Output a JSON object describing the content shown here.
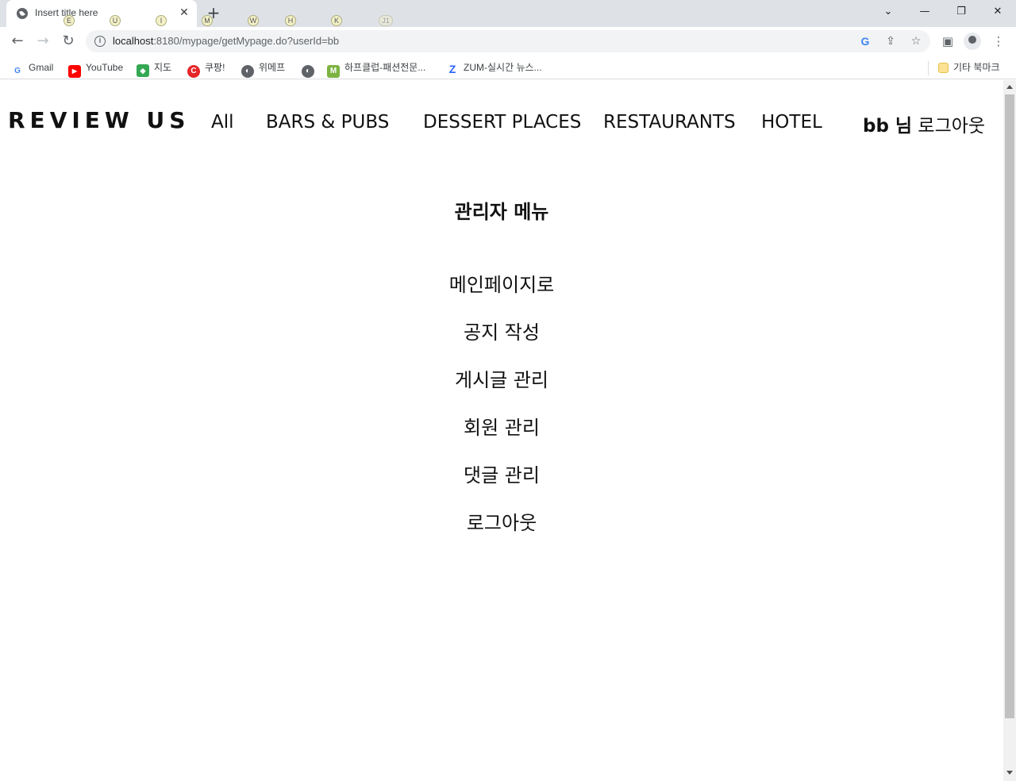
{
  "browser": {
    "tab_title": "Insert title here",
    "hints": [
      "E",
      "U",
      "I",
      "M",
      "W",
      "H",
      "K",
      "J1"
    ],
    "url_host": "localhost",
    "url_rest": ":8180/mypage/getMypage.do?userId=bb",
    "bookmarks": [
      {
        "label": "Gmail",
        "icon": "google-icon",
        "color": "#4285f4"
      },
      {
        "label": "YouTube",
        "icon": "youtube-icon",
        "color": "#ff0000"
      },
      {
        "label": "지도",
        "icon": "maps-icon",
        "color": "#34a853"
      },
      {
        "label": "쿠팡!",
        "icon": "coupang-icon",
        "color": "#e52528"
      },
      {
        "label": "위메프",
        "icon": "globe-icon",
        "color": "#5f6368"
      },
      {
        "label": "",
        "icon": "globe-icon",
        "color": "#5f6368"
      },
      {
        "label": "하프클럽-패션전문...",
        "icon": "halfclub-icon",
        "color": "#7cb342"
      },
      {
        "label": "ZUM-실시간 뉴스...",
        "icon": "zum-icon",
        "color": "#2962ff"
      }
    ],
    "other_bookmarks": "기타 북마크"
  },
  "site": {
    "logo": "REVIEW US",
    "nav": [
      "All",
      "BARS & PUBS",
      "DESSERT PLACES",
      "RESTAURANTS",
      "HOTEL"
    ],
    "user_name": "bb 님",
    "logout": "로그아웃"
  },
  "admin": {
    "title": "관리자 메뉴",
    "menu": [
      "메인페이지로",
      "공지 작성",
      "게시글 관리",
      "회원 관리",
      "댓글 관리",
      "로그아웃"
    ]
  }
}
